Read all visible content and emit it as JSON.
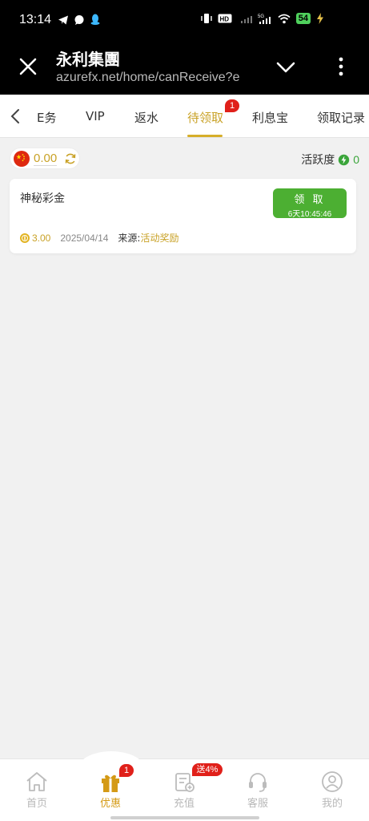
{
  "status_bar": {
    "time": "13:14",
    "battery": "54"
  },
  "browser": {
    "title": "永利集團",
    "url": "azurefx.net/home/canReceive?e"
  },
  "tabs": [
    {
      "label": "E务"
    },
    {
      "label": "VIP"
    },
    {
      "label": "返水"
    },
    {
      "label": "待领取",
      "badge": "1",
      "active": true
    },
    {
      "label": "利息宝"
    },
    {
      "label": "领取记录"
    }
  ],
  "balance": {
    "amount": "0.00"
  },
  "activity": {
    "label": "活跃度",
    "value": "0"
  },
  "reward_card": {
    "title": "神秘彩金",
    "button_label": "领 取",
    "countdown": "6天10:45:46",
    "amount": "3.00",
    "date": "2025/04/14",
    "source_label": "来源:",
    "source": "活动奖励"
  },
  "bottom_nav": [
    {
      "label": "首页",
      "icon": "home-icon"
    },
    {
      "label": "优惠",
      "icon": "gift-icon",
      "badge": "1",
      "active": true
    },
    {
      "label": "充值",
      "icon": "deposit-icon",
      "badge": "送4%"
    },
    {
      "label": "客服",
      "icon": "headset-icon"
    },
    {
      "label": "我的",
      "icon": "user-icon"
    }
  ],
  "colors": {
    "accent": "#c9a227",
    "claim_green": "#4caf32",
    "badge_red": "#e0201a"
  }
}
